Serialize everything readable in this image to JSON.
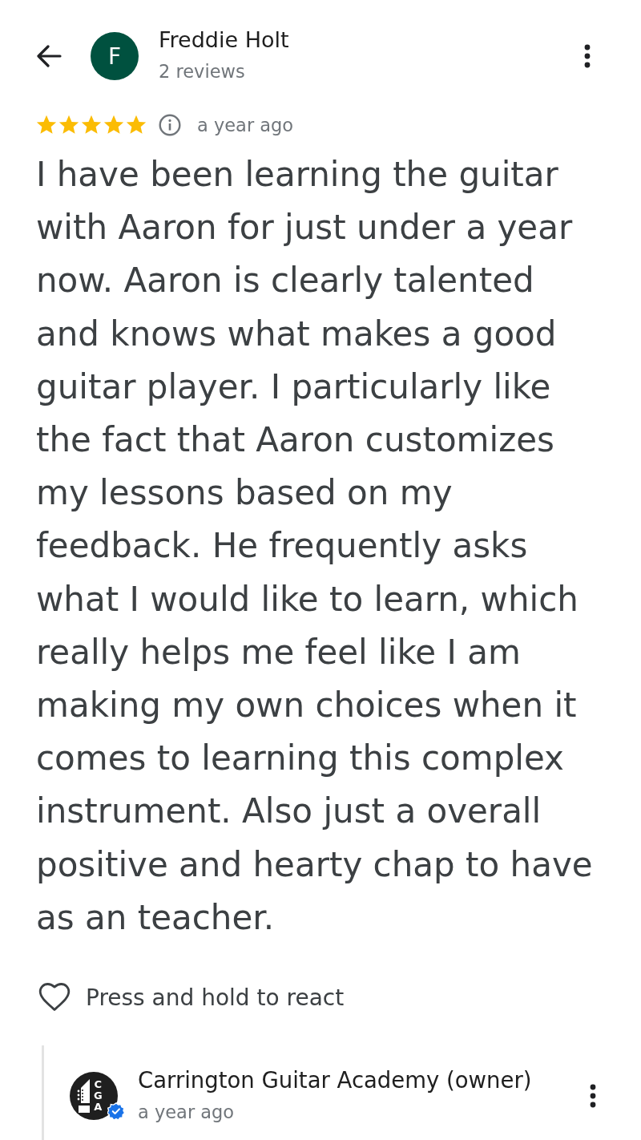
{
  "author": {
    "avatar_letter": "F",
    "name": "Freddie Holt",
    "review_count": "2 reviews"
  },
  "review": {
    "stars": 5,
    "time": "a year ago",
    "text": "I have been learning the guitar with Aaron for just under a year now. Aaron is clearly talented and knows what makes a good guitar player. I particularly like the fact that Aaron customizes my lessons based on my feedback. He frequently asks what I would like to learn, which really helps me feel like I am making my own choices when it comes to learning this complex instrument. Also just a overall positive and hearty chap to have as an teacher."
  },
  "reaction": {
    "label": "Press and hold to react",
    "reacted": false
  },
  "owner_reply": {
    "logo_letters": [
      "C",
      "G",
      "A"
    ],
    "verified": true,
    "name": "Carrington Guitar Academy (owner)",
    "time": "a year ago"
  }
}
